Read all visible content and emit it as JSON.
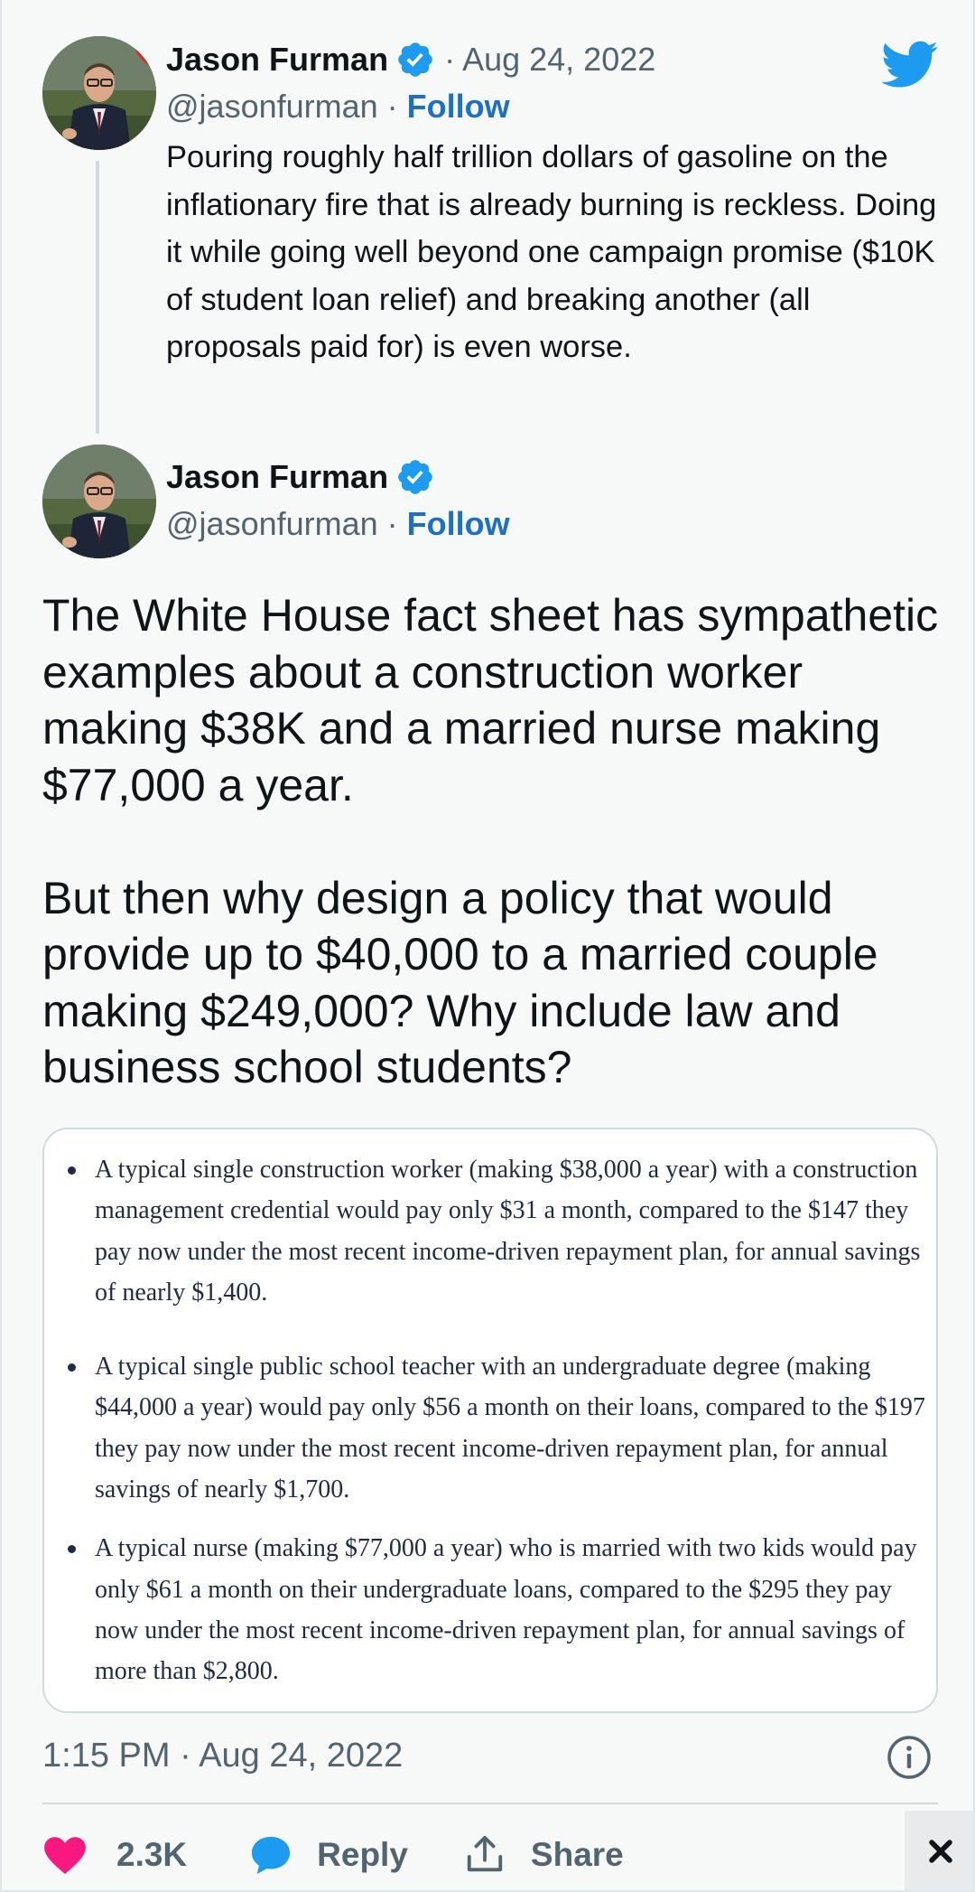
{
  "colors": {
    "background": "#f7f9f9",
    "text": "#0f1419",
    "secondary": "#536471",
    "link": "#1d70c4",
    "like": "#f91880",
    "reply": "#1d9bf0",
    "twitter_blue": "#1d9bf0"
  },
  "icons": {
    "logo": "twitter-bird-icon",
    "verified": "verified-badge-icon",
    "info": "info-icon",
    "like": "heart-icon",
    "reply": "speech-bubble-icon",
    "share": "share-icon",
    "close": "close-icon"
  },
  "parent_tweet": {
    "author_name": "Jason Furman",
    "date": "· Aug 24, 2022",
    "handle": "@jasonfurman",
    "separator": "·",
    "follow_label": "Follow",
    "text": "Pouring roughly half trillion dollars of gasoline on the inflationary fire that is already burning is reckless. Doing it while going well beyond one campaign promise ($10K of student loan relief) and breaking another (all proposals paid for) is even worse."
  },
  "main_tweet": {
    "author_name": "Jason Furman",
    "handle": "@jasonfurman",
    "separator": "·",
    "follow_label": "Follow",
    "paragraph_1": "The White House fact sheet has sympathetic examples about a construction worker making $38K and a married nurse making $77,000 a year.",
    "paragraph_2": "But then why design a policy that would provide up to $40,000 to a married couple making $249,000? Why include law and business school students?",
    "image_bullets": [
      "A typical single construction worker (making $38,000 a year) with a construction management credential would pay only $31 a month, compared to the $147 they pay now under the most recent income-driven repayment plan, for annual savings of nearly $1,400.",
      "A typical single public school teacher with an undergraduate degree (making $44,000 a year) would pay only $56 a month on their loans, compared to the $197 they pay now under the most recent income-driven repayment plan, for annual savings of nearly $1,700.",
      "A typical nurse (making $77,000 a year) who is married with two kids would pay only $61 a month on their undergraduate loans, compared to the $295 they pay now under the most recent income-driven repayment plan, for annual savings of more than $2,800."
    ],
    "timestamp": "1:15 PM · Aug 24, 2022"
  },
  "actions": {
    "like_count": "2.3K",
    "reply_label": "Reply",
    "share_label": "Share"
  }
}
